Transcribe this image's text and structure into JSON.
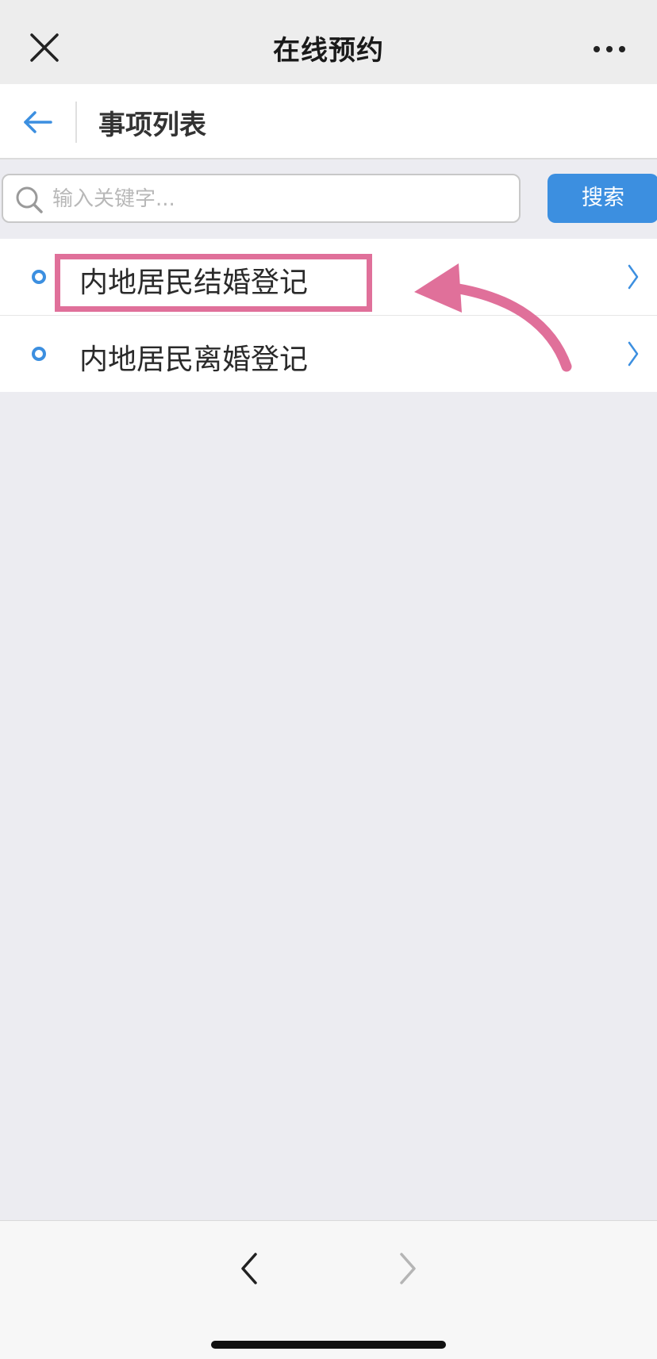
{
  "titlebar": {
    "title": "在线预约",
    "close_icon": "close-icon",
    "more_icon": "more-dots-icon"
  },
  "subheader": {
    "back_icon": "arrow-left-icon",
    "title": "事项列表"
  },
  "search": {
    "placeholder": "输入关键字...",
    "value": "",
    "button_label": "搜索",
    "icon": "search-icon"
  },
  "items": [
    {
      "label": "内地居民结婚登记",
      "highlighted": true
    },
    {
      "label": "内地居民离婚登记",
      "highlighted": false
    }
  ],
  "bottom_nav": {
    "back_icon": "chevron-left-icon",
    "forward_icon": "chevron-right-icon",
    "forward_enabled": false
  },
  "colors": {
    "accent": "#3c8fe0",
    "annotation": "#e0709a",
    "background": "#ececf1"
  }
}
